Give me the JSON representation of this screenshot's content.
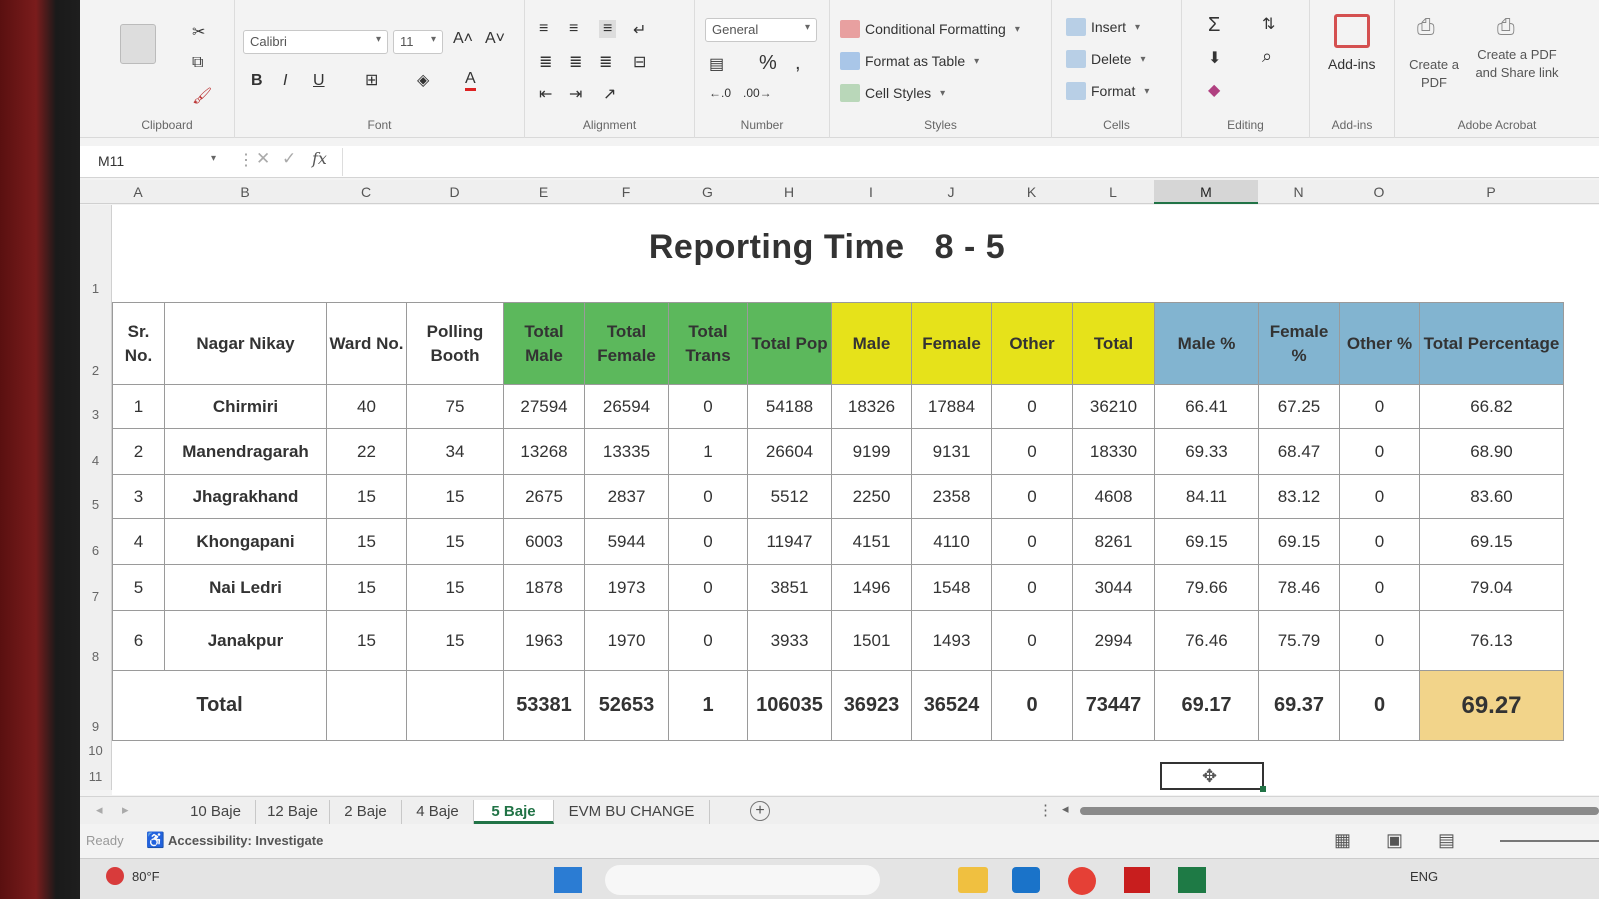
{
  "ribbon": {
    "font_name": "Calibri",
    "font_size": "11",
    "number_format": "General",
    "groups": {
      "clipboard": "Clipboard",
      "font": "Font",
      "alignment": "Alignment",
      "number": "Number",
      "styles": "Styles",
      "cells": "Cells",
      "editing": "Editing",
      "addins": "Add-ins",
      "adobe": "Adobe Acrobat"
    },
    "styles_buttons": {
      "conditional": "Conditional Formatting",
      "format_table": "Format as Table",
      "cell_styles": "Cell Styles"
    },
    "cells_buttons": {
      "insert": "Insert",
      "delete": "Delete",
      "format": "Format"
    },
    "addins_label": "Add-ins",
    "create_pdf": "Create a PDF",
    "create_share": "Create a PDF and Share link"
  },
  "formula_bar": {
    "name_box": "M11",
    "fx": "fx"
  },
  "columns": [
    "A",
    "B",
    "C",
    "D",
    "E",
    "F",
    "G",
    "H",
    "I",
    "J",
    "K",
    "L",
    "M",
    "N",
    "O",
    "P"
  ],
  "selected_column": "M",
  "rows": [
    "1",
    "2",
    "3",
    "4",
    "5",
    "6",
    "7",
    "8",
    "9",
    "10",
    "11"
  ],
  "sheet": {
    "title_left": "Reporting Time",
    "title_right": "8 - 5",
    "headers": [
      "Sr. No.",
      "Nagar Nikay",
      "Ward No.",
      "Polling Booth",
      "Total Male",
      "Total Female",
      "Total Trans",
      "Total Pop",
      "Male",
      "Female",
      "Other",
      "Total",
      "Male %",
      "Female %",
      "Other %",
      "Total Percentage"
    ],
    "data": [
      [
        "1",
        "Chirmiri",
        "40",
        "75",
        "27594",
        "26594",
        "0",
        "54188",
        "18326",
        "17884",
        "0",
        "36210",
        "66.41",
        "67.25",
        "0",
        "66.82"
      ],
      [
        "2",
        "Manendragarah",
        "22",
        "34",
        "13268",
        "13335",
        "1",
        "26604",
        "9199",
        "9131",
        "0",
        "18330",
        "69.33",
        "68.47",
        "0",
        "68.90"
      ],
      [
        "3",
        "Jhagrakhand",
        "15",
        "15",
        "2675",
        "2837",
        "0",
        "5512",
        "2250",
        "2358",
        "0",
        "4608",
        "84.11",
        "83.12",
        "0",
        "83.60"
      ],
      [
        "4",
        "Khongapani",
        "15",
        "15",
        "6003",
        "5944",
        "0",
        "11947",
        "4151",
        "4110",
        "0",
        "8261",
        "69.15",
        "69.15",
        "0",
        "69.15"
      ],
      [
        "5",
        "Nai Ledri",
        "15",
        "15",
        "1878",
        "1973",
        "0",
        "3851",
        "1496",
        "1548",
        "0",
        "3044",
        "79.66",
        "78.46",
        "0",
        "79.04"
      ],
      [
        "6",
        "Janakpur",
        "15",
        "15",
        "1963",
        "1970",
        "0",
        "3933",
        "1501",
        "1493",
        "0",
        "2994",
        "76.46",
        "75.79",
        "0",
        "76.13"
      ]
    ],
    "total_row": [
      "Total",
      "",
      "",
      "53381",
      "52653",
      "1",
      "106035",
      "36923",
      "36524",
      "0",
      "73447",
      "69.17",
      "69.37",
      "0",
      "69.27"
    ],
    "colors": {
      "green": "#5cb85c",
      "yellow": "#e6e21a",
      "blue": "#82b4d0",
      "gold": "#f2d48a"
    }
  },
  "tabs": [
    "10 Baje",
    "12 Baje",
    "2 Baje",
    "4 Baje",
    "5 Baje",
    "EVM BU CHANGE"
  ],
  "active_tab": "5 Baje",
  "status": {
    "ready": "Ready",
    "accessibility": "Accessibility: Investigate",
    "weather": "80°F",
    "lang": "ENG"
  }
}
